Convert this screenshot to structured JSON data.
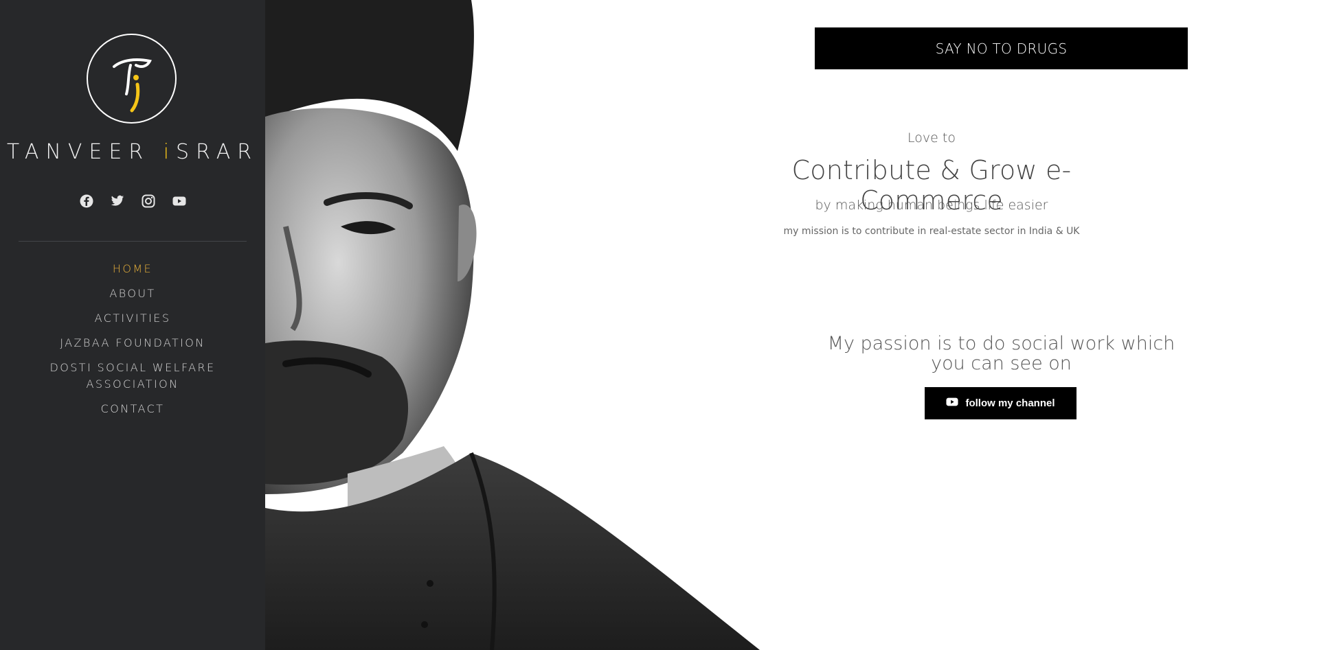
{
  "sidebar": {
    "brand_main": "TANVEER ",
    "brand_accent": "i",
    "brand_tail": "SRAR",
    "socials": [
      {
        "icon": "facebook-icon"
      },
      {
        "icon": "twitter-icon"
      },
      {
        "icon": "instagram-icon"
      },
      {
        "icon": "youtube-icon"
      }
    ],
    "nav": [
      {
        "label": "HOME",
        "active": true
      },
      {
        "label": "ABOUT",
        "active": false
      },
      {
        "label": "ACTIVITIES",
        "active": false
      },
      {
        "label": "JAZBAA FOUNDATION",
        "active": false
      },
      {
        "label": "DOSTI SOCIAL WELFARE ASSOCIATION",
        "active": false
      },
      {
        "label": "CONTACT",
        "active": false
      }
    ]
  },
  "main": {
    "cta_label": "SAY NO TO DRUGS",
    "love_to": "Love to",
    "headline": "Contribute & Grow e-Commerce",
    "subline": "by making human beings life easier",
    "mission": "my mission is to contribute in real-estate sector in India & UK",
    "passion": "My passion is to do social work which you can see on",
    "channel_button": "follow my channel"
  },
  "colors": {
    "sidebar_bg": "#27282a",
    "accent": "#f5c518",
    "nav_active": "#e8b13a",
    "button_bg": "#000000"
  }
}
